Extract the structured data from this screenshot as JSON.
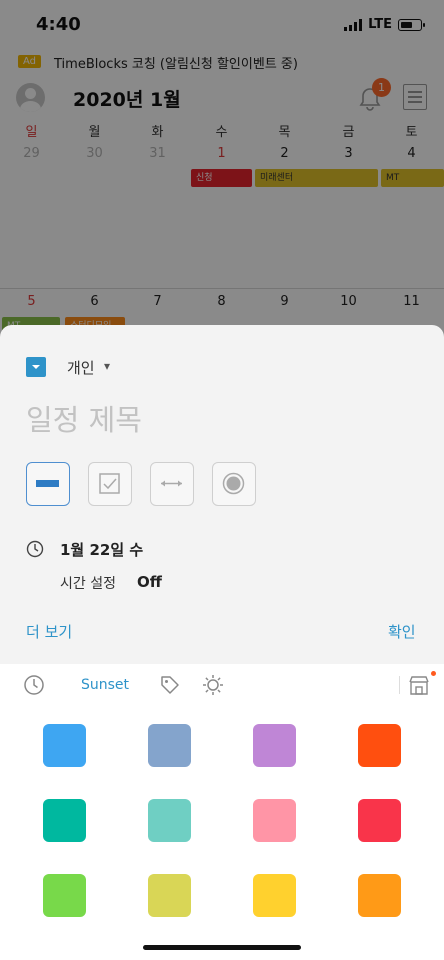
{
  "status": {
    "time": "4:40",
    "network": "LTE"
  },
  "banner": {
    "ad_label": "Ad",
    "text": "TimeBlocks 코칭 (알림신청 할인이벤트 중)"
  },
  "header": {
    "month_title": "2020년 1월",
    "notification_count": "1"
  },
  "calendar": {
    "weekdays": [
      "일",
      "월",
      "화",
      "수",
      "목",
      "금",
      "토"
    ],
    "week1": [
      "29",
      "30",
      "31",
      "1",
      "2",
      "3",
      "4"
    ],
    "week2": [
      "5",
      "6",
      "7",
      "8",
      "9",
      "10",
      "11"
    ],
    "events": [
      {
        "label": "신청",
        "color": "#e8232e"
      },
      {
        "label": "미래센터",
        "color": "#e2c22a"
      },
      {
        "label": "MT",
        "color": "#e2c22a"
      },
      {
        "label": "MT",
        "color": "#8bc34a"
      },
      {
        "label": "스터디모임",
        "color": "#ff8c1a"
      }
    ]
  },
  "sheet": {
    "category": "개인",
    "category_color": "#2e93c9",
    "title_placeholder": "일정 제목",
    "date": "1월 22일 수",
    "time_setting_label": "시간 설정",
    "time_setting_value": "Off",
    "more_label": "더 보기",
    "confirm_label": "확인"
  },
  "palette": {
    "tab_label": "Sunset",
    "colors": [
      "#3ea6f2",
      "#84a4cc",
      "#bf86d6",
      "#ff4f0f",
      "#00b89f",
      "#6fcfc3",
      "#ff95a6",
      "#f9344a",
      "#78d94a",
      "#d9d656",
      "#ffd12e",
      "#ff9a17"
    ]
  }
}
